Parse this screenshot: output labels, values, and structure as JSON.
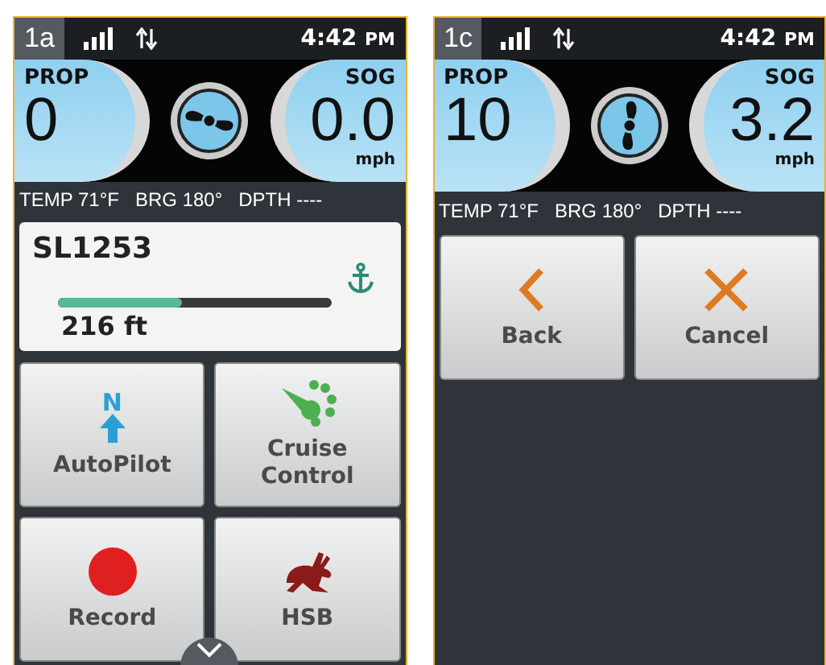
{
  "screens": [
    {
      "tag": "1a",
      "time": "4:42",
      "meridiem": "PM",
      "prop": {
        "label": "PROP",
        "value": "0"
      },
      "sog": {
        "label": "SOG",
        "value": "0.0",
        "unit": "mph"
      },
      "info": [
        {
          "label": "TEMP",
          "value": "71°F"
        },
        {
          "label": "BRG",
          "value": "180°"
        },
        {
          "label": "DPTH",
          "value": "----"
        }
      ],
      "waypoint": {
        "name": "SL1253",
        "distance": "216 ft",
        "level": 0.45
      },
      "buttons": [
        {
          "kind": "autopilot",
          "label": "AutoPilot",
          "icon_text": "N"
        },
        {
          "kind": "cruise",
          "label": "Cruise Control"
        },
        {
          "kind": "record",
          "label": "Record"
        },
        {
          "kind": "hsb",
          "label": "HSB"
        }
      ],
      "more": true
    },
    {
      "tag": "1c",
      "time": "4:42",
      "meridiem": "PM",
      "prop": {
        "label": "PROP",
        "value": "10"
      },
      "sog": {
        "label": "SOG",
        "value": "3.2",
        "unit": "mph"
      },
      "info": [
        {
          "label": "TEMP",
          "value": "71°F"
        },
        {
          "label": "BRG",
          "value": "180°"
        },
        {
          "label": "DPTH",
          "value": "----"
        }
      ],
      "buttons": [
        {
          "kind": "back",
          "label": "Back"
        },
        {
          "kind": "cancel",
          "label": "Cancel"
        }
      ],
      "more": false
    }
  ]
}
